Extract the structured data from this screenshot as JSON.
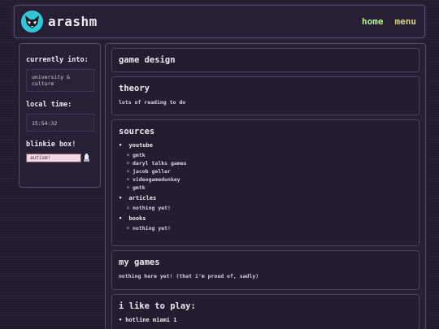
{
  "header": {
    "site_name": "arashm",
    "nav": [
      {
        "label": "home",
        "color": "#b6f08a"
      },
      {
        "label": "menu",
        "color": "#d6d184"
      }
    ]
  },
  "sidebar": {
    "currently_into_heading": "currently into:",
    "currently_into_value": "university & culture",
    "local_time_heading": "local time:",
    "local_time_value": "15:54:32",
    "blinkie_heading": "blinkie box!",
    "blinkie_text": "autism!"
  },
  "main": {
    "page_title": "game design",
    "theory": {
      "title": "theory",
      "text": "lots of reading to do"
    },
    "sources": {
      "title": "sources",
      "groups": [
        {
          "label": "youtube",
          "items": [
            "gmtk",
            "daryl talks games",
            "jacob geller",
            "videogamedunkey",
            "gmtk"
          ]
        },
        {
          "label": "articles",
          "items": [
            "nothing yet!"
          ]
        },
        {
          "label": "books",
          "items": [
            "nothing yet!"
          ]
        }
      ]
    },
    "my_games": {
      "title": "my games",
      "text": "nothing here yet! (that i'm proud of, sadly)"
    },
    "like_to_play": {
      "title": "i like to play:",
      "items": [
        "hotline miami 1"
      ]
    }
  },
  "colors": {
    "background": "#261f33",
    "border": "#5a4c6e",
    "logo_accent": "#33c6d6"
  }
}
